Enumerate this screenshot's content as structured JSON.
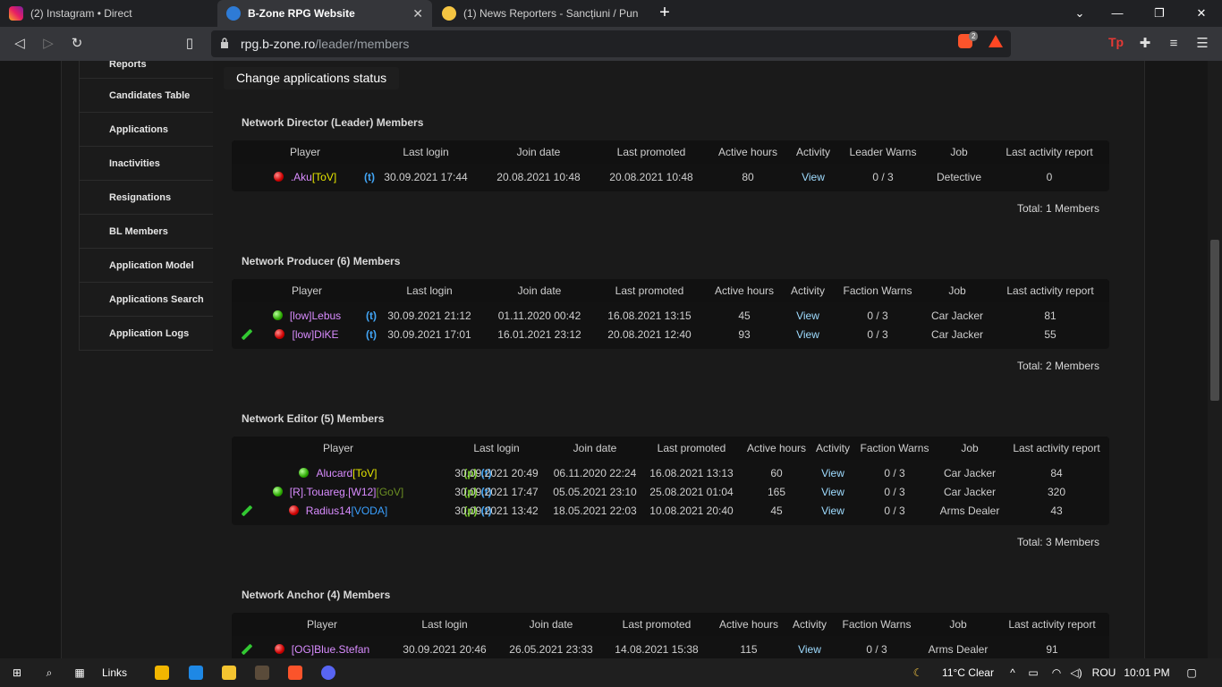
{
  "browser": {
    "tabs": [
      {
        "title": "(2) Instagram • Direct",
        "active": false
      },
      {
        "title": "B-Zone RPG Website",
        "active": true
      },
      {
        "title": "(1) News Reporters - Sancțiuni / Punish",
        "active": false
      }
    ],
    "new_tab": "+",
    "url_host": "rpg.b-zone.ro",
    "url_path": "/leader/members",
    "brave_count": "2",
    "tp_label": "Tp"
  },
  "sidebar": {
    "items": [
      "Reports",
      "Candidates Table",
      "Applications",
      "Inactivities",
      "Resignations",
      "BL Members",
      "Application Model",
      "Applications Search",
      "Application Logs"
    ]
  },
  "status_button": "Change applications status",
  "sections": [
    {
      "title": "Network Director (Leader) Members",
      "headers": [
        "Player",
        "Last login",
        "Join date",
        "Last promoted",
        "Active hours",
        "Activity",
        "Leader Warns",
        "Job",
        "Last activity report"
      ],
      "rows": [
        {
          "status": "red",
          "name": ".Aku",
          "tag": "[ToV]",
          "tag_color": "#e6e600",
          "flags": [
            "(t)"
          ],
          "last_login": "30.09.2021 17:44",
          "join_date": "20.08.2021 10:48",
          "last_promoted": "20.08.2021 10:48",
          "active_hours": "80",
          "activity": "View",
          "warns": "0 / 3",
          "job": "Detective",
          "report": "0",
          "edit": false
        }
      ],
      "total": "Total: 1 Members"
    },
    {
      "title": "Network Producer (6) Members",
      "headers": [
        "Player",
        "Last login",
        "Join date",
        "Last promoted",
        "Active hours",
        "Activity",
        "Faction Warns",
        "Job",
        "Last activity report"
      ],
      "rows": [
        {
          "status": "green",
          "name": "[low]Lebus",
          "tag": "",
          "tag_color": "",
          "flags": [
            "(t)"
          ],
          "last_login": "30.09.2021 21:12",
          "join_date": "01.11.2020 00:42",
          "last_promoted": "16.08.2021 13:15",
          "active_hours": "45",
          "activity": "View",
          "warns": "0 / 3",
          "job": "Car Jacker",
          "report": "81",
          "edit": false
        },
        {
          "status": "red",
          "name": "[low]DiKE",
          "tag": "",
          "tag_color": "",
          "flags": [
            "(t)"
          ],
          "last_login": "30.09.2021 17:01",
          "join_date": "16.01.2021 23:12",
          "last_promoted": "20.08.2021 12:40",
          "active_hours": "93",
          "activity": "View",
          "warns": "0 / 3",
          "job": "Car Jacker",
          "report": "55",
          "edit": true
        }
      ],
      "total": "Total: 2 Members"
    },
    {
      "title": "Network Editor (5) Members",
      "headers": [
        "Player",
        "Last login",
        "Join date",
        "Last promoted",
        "Active hours",
        "Activity",
        "Faction Warns",
        "Job",
        "Last activity report"
      ],
      "rows": [
        {
          "status": "green",
          "name": "Alucard",
          "tag": "[ToV]",
          "tag_color": "#e6e600",
          "flags": [
            "(p)",
            "(t)"
          ],
          "last_login": "30.09.2021 20:49",
          "join_date": "06.11.2020 22:24",
          "last_promoted": "16.08.2021 13:13",
          "active_hours": "60",
          "activity": "View",
          "warns": "0 / 3",
          "job": "Car Jacker",
          "report": "84",
          "edit": false
        },
        {
          "status": "green",
          "name": "[R].Touareg.[W12]",
          "tag": "[GoV]",
          "tag_color": "#6b8e23",
          "flags": [
            "(p)",
            "(t)"
          ],
          "last_login": "30.09.2021 17:47",
          "join_date": "05.05.2021 23:10",
          "last_promoted": "25.08.2021 01:04",
          "active_hours": "165",
          "activity": "View",
          "warns": "0 / 3",
          "job": "Car Jacker",
          "report": "320",
          "edit": false
        },
        {
          "status": "red",
          "name": "Radius14",
          "tag": "[VODA]",
          "tag_color": "#3aa0ff",
          "flags": [
            "(p)",
            "(t)"
          ],
          "last_login": "30.09.2021 13:42",
          "join_date": "18.05.2021 22:03",
          "last_promoted": "10.08.2021 20:40",
          "active_hours": "45",
          "activity": "View",
          "warns": "0 / 3",
          "job": "Arms Dealer",
          "report": "43",
          "edit": true
        }
      ],
      "total": "Total: 3 Members"
    },
    {
      "title": "Network Anchor (4) Members",
      "headers": [
        "Player",
        "Last login",
        "Join date",
        "Last promoted",
        "Active hours",
        "Activity",
        "Faction Warns",
        "Job",
        "Last activity report"
      ],
      "rows": [
        {
          "status": "red",
          "name": "[OG]Blue.Stefan",
          "tag": "",
          "tag_color": "",
          "flags": [],
          "last_login": "30.09.2021 20:46",
          "join_date": "26.05.2021 23:33",
          "last_promoted": "14.08.2021 15:38",
          "active_hours": "115",
          "activity": "View",
          "warns": "0 / 3",
          "job": "Arms Dealer",
          "report": "91",
          "edit": true
        }
      ],
      "total": ""
    }
  ],
  "taskbar": {
    "links_label": "Links",
    "weather": "11°C  Clear",
    "language": "ROU",
    "time": "10:01 PM"
  }
}
